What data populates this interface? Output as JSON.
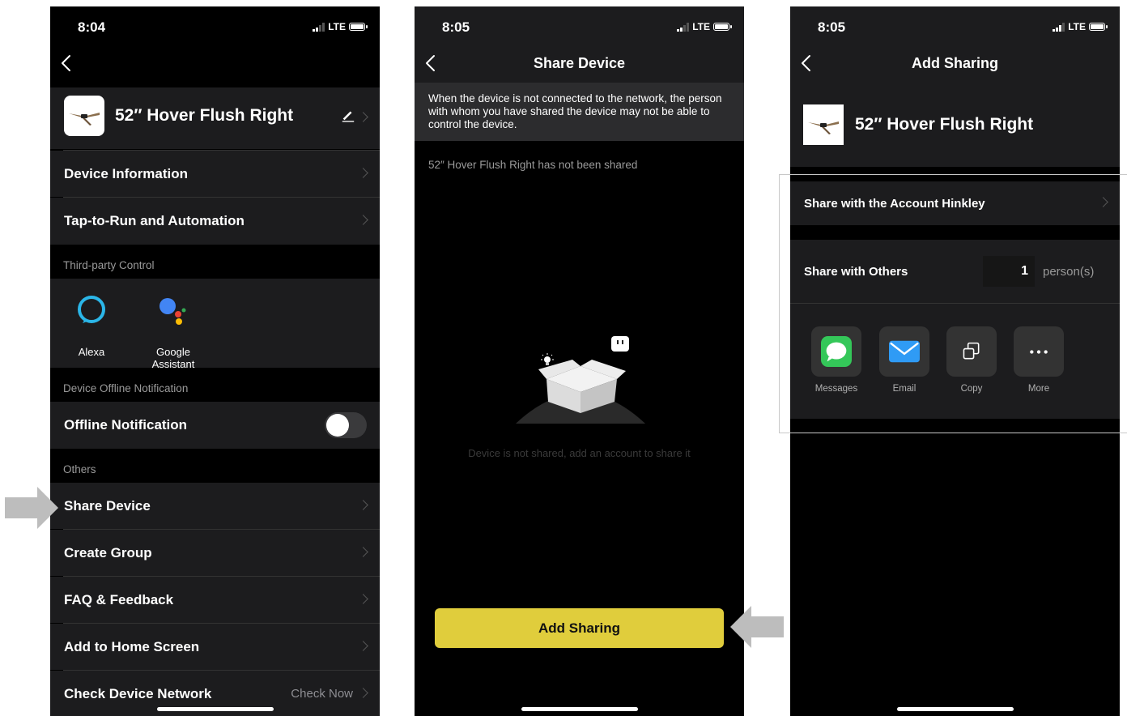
{
  "screen1": {
    "time": "8:04",
    "network": "LTE",
    "device_name": "52″ Hover Flush Right",
    "rows": {
      "device_info": "Device Information",
      "tap_to_run": "Tap-to-Run and Automation",
      "offline_notification": "Offline Notification",
      "share_device": "Share Device",
      "create_group": "Create Group",
      "faq": "FAQ & Feedback",
      "add_home": "Add to Home Screen",
      "check_network": "Check Device Network",
      "check_now": "Check Now"
    },
    "sections": {
      "third_party": "Third-party Control",
      "offline": "Device Offline Notification",
      "others": "Others"
    },
    "third_party": [
      {
        "label": "Alexa",
        "icon": "alexa-icon"
      },
      {
        "label": "Google Assistant",
        "icon": "google-assistant-icon"
      }
    ],
    "offline_toggle_on": false
  },
  "screen2": {
    "time": "8:05",
    "network": "LTE",
    "title": "Share Device",
    "notice": "When the device is not connected to the network, the person with whom you have shared the device may not be able to control the device.",
    "not_shared": "52″ Hover Flush Right has not been shared",
    "empty_text": "Device is not shared, add an account to share it",
    "add_button": "Add Sharing"
  },
  "screen3": {
    "time": "8:05",
    "network": "LTE",
    "title": "Add Sharing",
    "device_name": "52″ Hover Flush Right",
    "share_account": "Share with the Account Hinkley",
    "share_others": "Share with Others",
    "person_count": "1",
    "person_unit": "person(s)",
    "apps": [
      {
        "label": "Messages",
        "icon": "messages-icon"
      },
      {
        "label": "Email",
        "icon": "email-icon"
      },
      {
        "label": "Copy",
        "icon": "copy-icon"
      },
      {
        "label": "More",
        "icon": "more-icon"
      }
    ]
  },
  "colors": {
    "accent_yellow": "#e0cd3c",
    "row_bg": "#1c1c1e",
    "messages_green": "#34c759",
    "email_blue": "#2f9bf5",
    "arrow_gray": "#bdbdbd"
  }
}
